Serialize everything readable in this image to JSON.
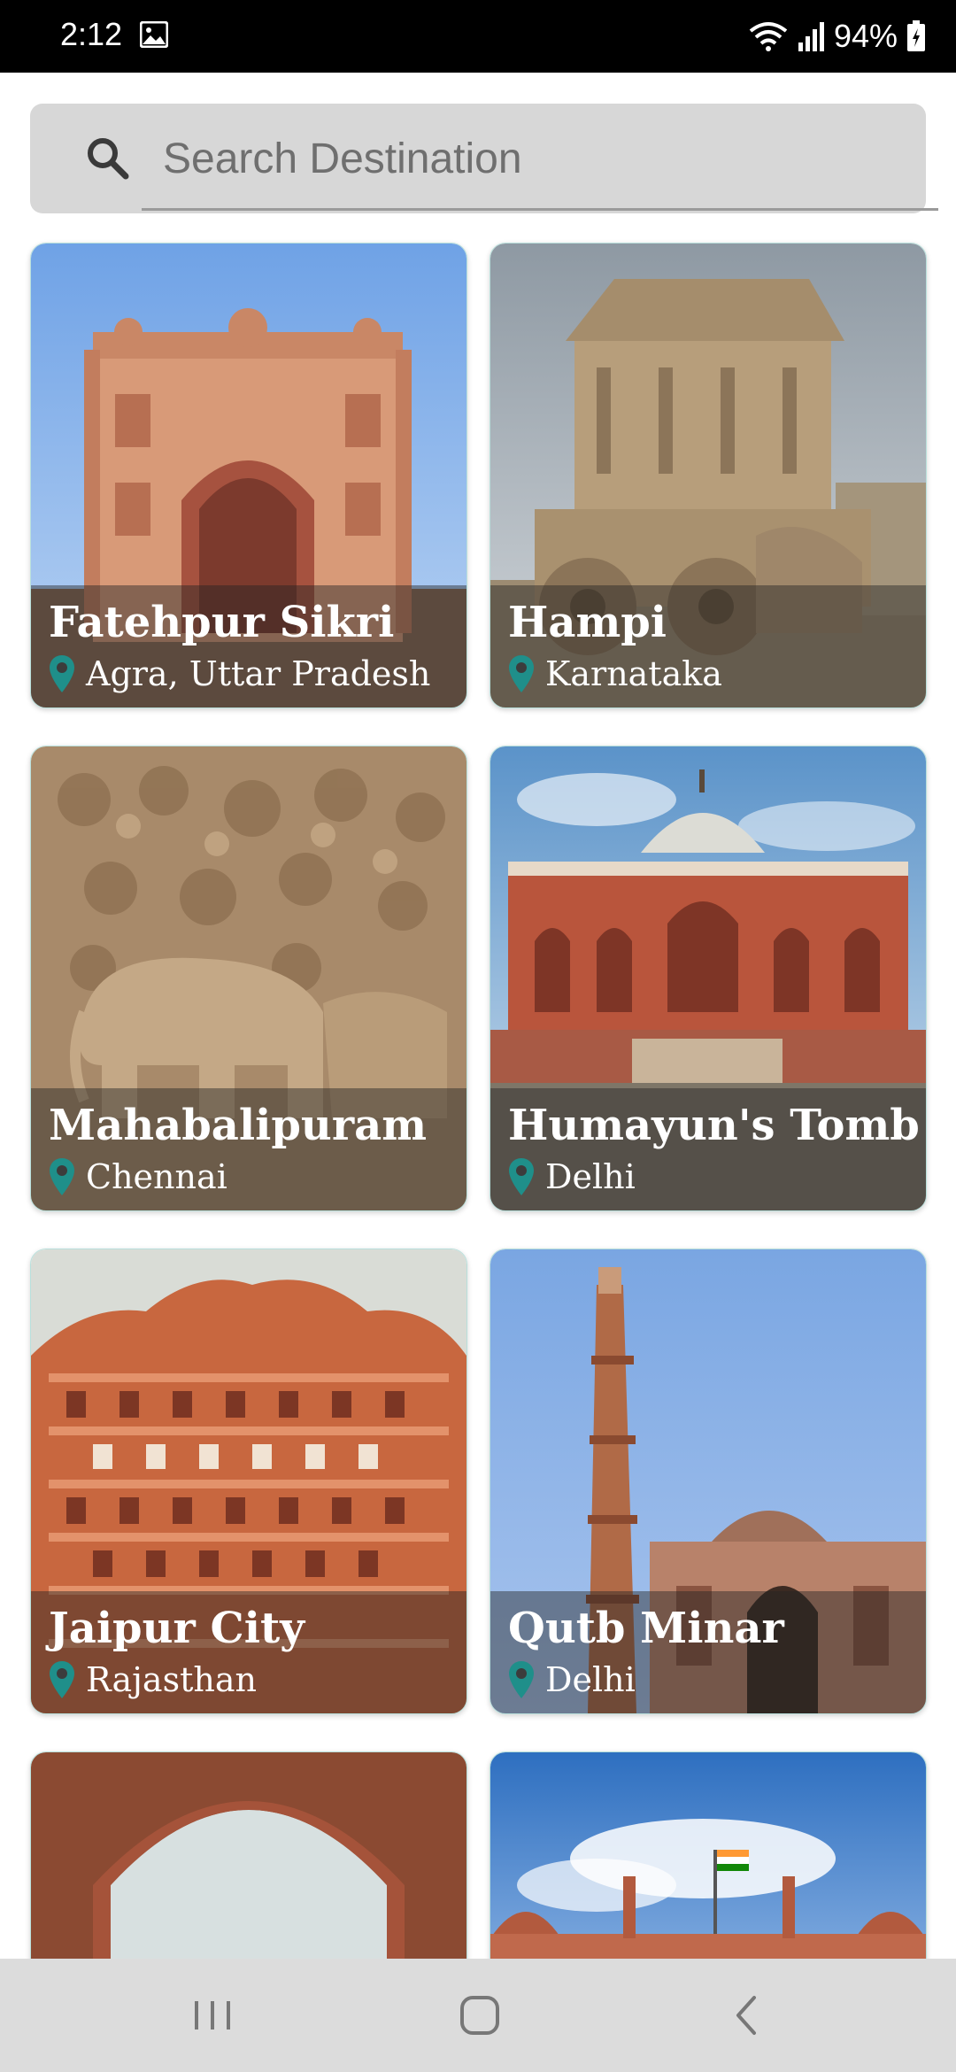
{
  "status_bar": {
    "time": "2:12",
    "battery_text": "94%",
    "icons": [
      "gallery-icon",
      "wifi-icon",
      "signal-icon",
      "battery-icon"
    ]
  },
  "search": {
    "placeholder": "Search Destination",
    "value": ""
  },
  "destinations": [
    {
      "title": "Fatehpur Sikri",
      "location": "Agra, Uttar Pradesh"
    },
    {
      "title": "Hampi",
      "location": "Karnataka"
    },
    {
      "title": "Mahabalipuram",
      "location": "Chennai"
    },
    {
      "title": "Humayun's Tomb",
      "location": "Delhi"
    },
    {
      "title": "Jaipur City",
      "location": "Rajasthan"
    },
    {
      "title": "Qutb Minar",
      "location": "Delhi"
    }
  ],
  "colors": {
    "accent_pin": "#1f8f8a",
    "search_bg": "#d7d7d7",
    "nav_bg": "#dcdcdc"
  },
  "nav": {
    "icons": [
      "recent-apps-icon",
      "home-icon",
      "back-icon"
    ]
  }
}
